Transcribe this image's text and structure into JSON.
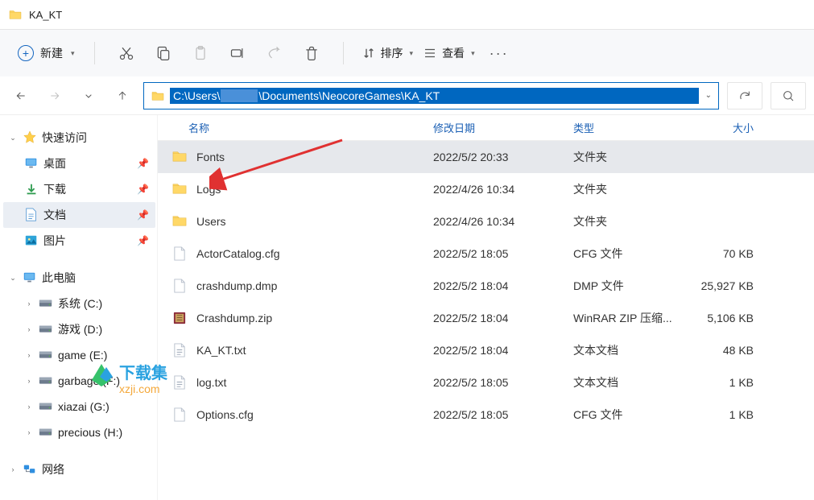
{
  "title": "KA_KT",
  "toolbar": {
    "new_label": "新建",
    "sort_label": "排序",
    "view_label": "查看"
  },
  "address": {
    "prefix": "C:\\Users\\",
    "suffix": "\\Documents\\NeocoreGames\\KA_KT"
  },
  "columns": {
    "name": "名称",
    "date": "修改日期",
    "type": "类型",
    "size": "大小"
  },
  "tree": {
    "quick": "快速访问",
    "desktop": "桌面",
    "downloads": "下载",
    "documents": "文档",
    "pictures": "图片",
    "this_pc": "此电脑",
    "drive_c": "系统 (C:)",
    "drive_d": "游戏 (D:)",
    "drive_e": "game (E:)",
    "drive_f": "garbage (F:)",
    "drive_g": "xiazai (G:)",
    "drive_h": "precious (H:)",
    "network": "网络"
  },
  "files": [
    {
      "name": "Fonts",
      "date": "2022/5/2 20:33",
      "type": "文件夹",
      "size": "",
      "icon": "folder",
      "selected": true
    },
    {
      "name": "Logs",
      "date": "2022/4/26 10:34",
      "type": "文件夹",
      "size": "",
      "icon": "folder"
    },
    {
      "name": "Users",
      "date": "2022/4/26 10:34",
      "type": "文件夹",
      "size": "",
      "icon": "folder"
    },
    {
      "name": "ActorCatalog.cfg",
      "date": "2022/5/2 18:05",
      "type": "CFG 文件",
      "size": "70 KB",
      "icon": "file"
    },
    {
      "name": "crashdump.dmp",
      "date": "2022/5/2 18:04",
      "type": "DMP 文件",
      "size": "25,927 KB",
      "icon": "file"
    },
    {
      "name": "Crashdump.zip",
      "date": "2022/5/2 18:04",
      "type": "WinRAR ZIP 压缩...",
      "size": "5,106 KB",
      "icon": "zip"
    },
    {
      "name": "KA_KT.txt",
      "date": "2022/5/2 18:04",
      "type": "文本文档",
      "size": "48 KB",
      "icon": "txt"
    },
    {
      "name": "log.txt",
      "date": "2022/5/2 18:05",
      "type": "文本文档",
      "size": "1 KB",
      "icon": "txt"
    },
    {
      "name": "Options.cfg",
      "date": "2022/5/2 18:05",
      "type": "CFG 文件",
      "size": "1 KB",
      "icon": "file"
    }
  ],
  "watermark": {
    "line1": "下载集",
    "line2": "xzji.com"
  }
}
